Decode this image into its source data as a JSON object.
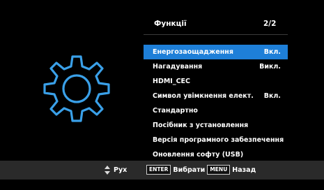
{
  "menu": {
    "title": "Функції",
    "page": "2/2",
    "items": [
      {
        "label": "Енергозаощадження",
        "value": "Вкл.",
        "selected": true
      },
      {
        "label": "Нагадування",
        "value": "Викл."
      },
      {
        "label": "HDMI_CEC",
        "value": ""
      },
      {
        "label": "Символ увімкнення елект.",
        "value": "Вкл."
      },
      {
        "label": "Стандартно",
        "value": ""
      },
      {
        "label": "Посібник з установлення",
        "value": ""
      },
      {
        "label": "Версія програмного забезпечення",
        "value": ""
      },
      {
        "label": "Оновлення софту (USB)",
        "value": ""
      }
    ]
  },
  "footer": {
    "move_label": "Рух",
    "enter_key": "ENTER",
    "select_label": "Вибрати",
    "menu_key": "MENU",
    "back_label": "Назад"
  },
  "icons": {
    "settings": "gear-icon",
    "nav": "up-down-arrows-icon"
  },
  "colors": {
    "accent": "#1e7fd8",
    "gear": "#3aa0e8",
    "footer_bg": "#2a2a2a"
  }
}
